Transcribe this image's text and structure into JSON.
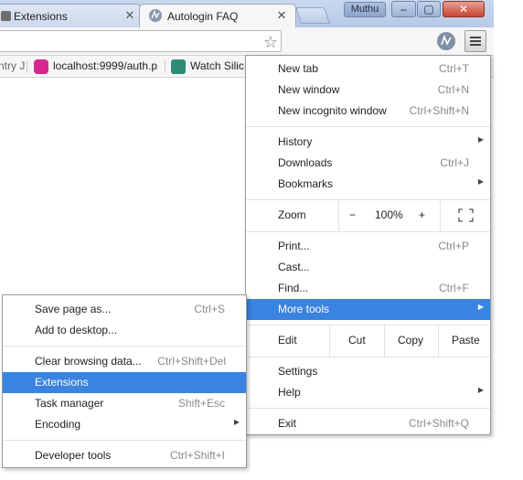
{
  "tabs": [
    {
      "label": "Extensions",
      "active": false
    },
    {
      "label": "Autologin FAQ",
      "active": true
    }
  ],
  "window": {
    "user": "Muthu",
    "minimize": "–",
    "maximize": "▢",
    "close": "✕"
  },
  "bookmarks": [
    {
      "label": "ntry J"
    },
    {
      "label": "localhost:9999/auth.p"
    },
    {
      "label": "Watch Silic"
    }
  ],
  "main_menu": {
    "items": [
      {
        "label": "New tab",
        "shortcut": "Ctrl+T"
      },
      {
        "label": "New window",
        "shortcut": "Ctrl+N"
      },
      {
        "label": "New incognito window",
        "shortcut": "Ctrl+Shift+N"
      },
      {
        "label": "History",
        "submenu": true
      },
      {
        "label": "Downloads",
        "shortcut": "Ctrl+J"
      },
      {
        "label": "Bookmarks",
        "submenu": true
      },
      {
        "label": "Print...",
        "shortcut": "Ctrl+P"
      },
      {
        "label": "Cast..."
      },
      {
        "label": "Find...",
        "shortcut": "Ctrl+F"
      },
      {
        "label": "More tools",
        "submenu": true,
        "highlighted": true
      },
      {
        "label": "Settings"
      },
      {
        "label": "Help",
        "submenu": true
      },
      {
        "label": "Exit",
        "shortcut": "Ctrl+Shift+Q"
      }
    ],
    "zoom": {
      "label": "Zoom",
      "minus": "−",
      "value": "100%",
      "plus": "+"
    },
    "edit": {
      "label": "Edit",
      "cut": "Cut",
      "copy": "Copy",
      "paste": "Paste"
    }
  },
  "more_tools_menu": {
    "items": [
      {
        "label": "Save page as...",
        "shortcut": "Ctrl+S"
      },
      {
        "label": "Add to desktop..."
      },
      {
        "label": "Clear browsing data...",
        "shortcut": "Ctrl+Shift+Del"
      },
      {
        "label": "Extensions",
        "highlighted": true
      },
      {
        "label": "Task manager",
        "shortcut": "Shift+Esc"
      },
      {
        "label": "Encoding",
        "submenu": true
      },
      {
        "label": "Developer tools",
        "shortcut": "Ctrl+Shift+I"
      }
    ]
  },
  "colors": {
    "highlight": "#3b83e0",
    "tabstrip": "#c9d8ee"
  },
  "icons": {
    "submenu_arrow": "▶",
    "star": "☆"
  }
}
